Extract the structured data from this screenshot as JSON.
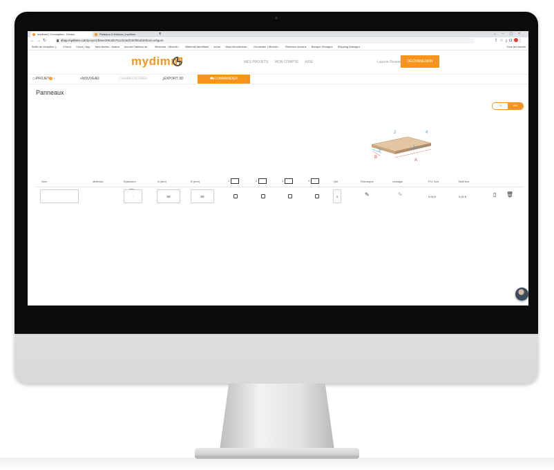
{
  "browser": {
    "tabs": [
      {
        "title": "mydimm | Conception - Dressi.."
      },
      {
        "title": "Plateaux & finitions | mydimm"
      }
    ],
    "url_host": "shop.mydimm.com",
    "url_path": "/project/b5ee3963d5751202a6f190f5bab05ba/configure",
    "bookmarks": [
      "Boîte de réception (...",
      "iCloud",
      "Cloud | App",
      "Mes tâches - Asana",
      "Accueil Tableau de...",
      "Welcome - Mixedin...",
      "Webmail Identifiant",
      "zohrs",
      "https://eurofideas...",
      "Hoodvider | Mixedin...",
      "Réseaux sociaux",
      "Banque d'images",
      "Shipping Manager"
    ],
    "bookmarks_right": "Tous les favoris"
  },
  "header": {
    "logo": "mydimm",
    "nav": [
      "MES PROJETS",
      "MON COMPTE",
      "AIDE"
    ],
    "user": "Laurine Rossion",
    "logout": "DÉCONNEXION"
  },
  "toolbar": {
    "projet": "PROJET",
    "projet_count": "1",
    "nouveau": "NOUVEAU",
    "enregistrer": "ENREGISTRER",
    "export": "EXPORT 3D",
    "commander": "COMMANDER"
  },
  "page": {
    "title": "Panneaux",
    "toggle": [
      "CM",
      "MM"
    ]
  },
  "diagram": {
    "labels": [
      "2",
      "4",
      "1",
      "3",
      "B",
      "A"
    ]
  },
  "table": {
    "headers": {
      "nom": "Nom",
      "materiau": "Matériau",
      "epaisseur": "Epaisseur",
      "a": "A (mm)",
      "b": "B (mm)",
      "c1": "1",
      "c2": "2",
      "c3": "3",
      "c4": "4",
      "qte": "Qte",
      "remarque": "Remarque",
      "usinage": "Usinage",
      "pu": "P.U. ttva",
      "total": "Total ttva"
    },
    "row": {
      "nom": "",
      "epaisseur": "-",
      "a": "60",
      "b": "60",
      "qte": "1",
      "pu": "0.00 €",
      "total": "0.00 €"
    }
  },
  "colors": {
    "accent": "#f7941d"
  }
}
